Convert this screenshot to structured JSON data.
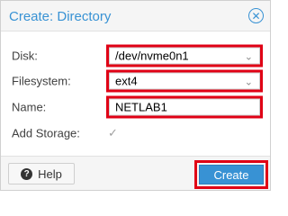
{
  "dialog": {
    "title": "Create: Directory",
    "close_icon": "close-icon"
  },
  "form": {
    "disk": {
      "label": "Disk:",
      "value": "/dev/nvme0n1"
    },
    "filesystem": {
      "label": "Filesystem:",
      "value": "ext4"
    },
    "name": {
      "label": "Name:",
      "value": "NETLAB1"
    },
    "add_storage": {
      "label": "Add Storage:",
      "checked": true
    }
  },
  "footer": {
    "help_label": "Help",
    "create_label": "Create"
  },
  "colors": {
    "accent": "#3892d4",
    "highlight": "#e00015"
  }
}
